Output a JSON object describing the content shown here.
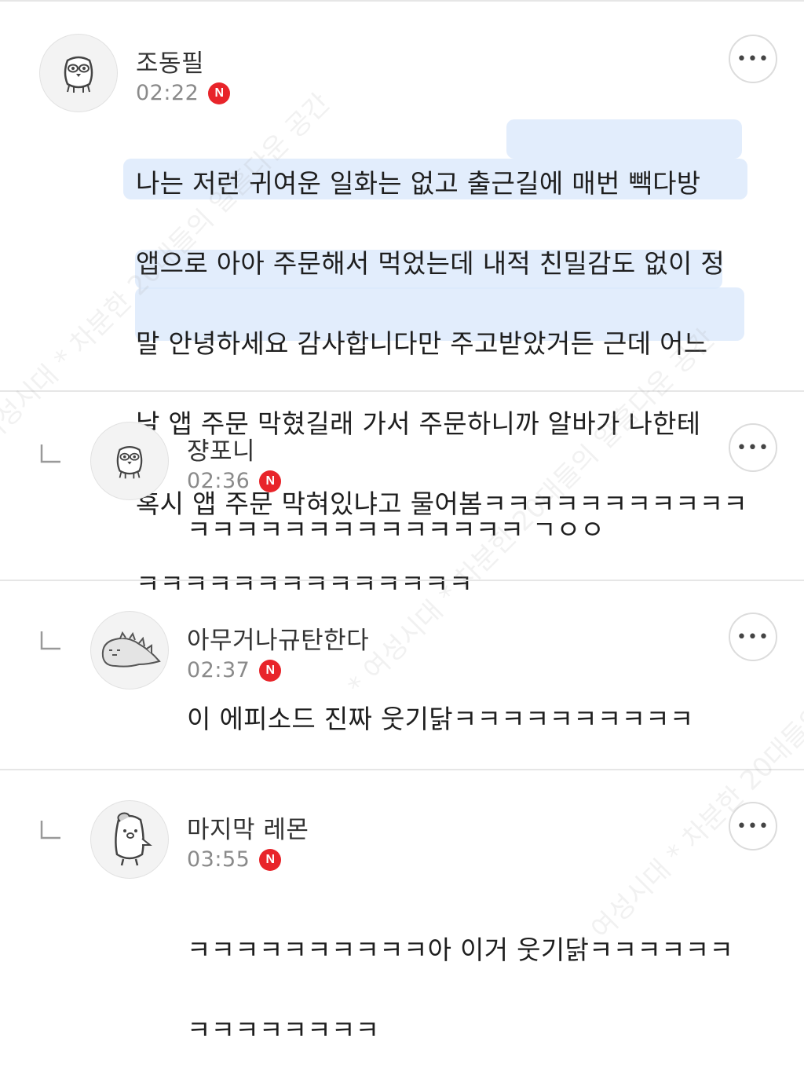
{
  "watermark": "* 여성시대 * 차분한 20대들의 알흠다운 공간",
  "more_label": "•••",
  "badge_label": "N",
  "badge_color": "#e8242a",
  "comments": [
    {
      "nickname": "조동필",
      "time": "02:22",
      "lines": [
        "나는 저런 귀여운 일화는 없고 출근길에 매번 빽다방",
        "앱으로 아아 주문해서 먹었는데 내적 친밀감도 없이 정",
        "말 안녕하세요 감사합니다만 주고받았거든 근데 어느",
        "날 앱 주문 막혔길래 가서 주문하니까 알바가 나한테",
        "혹시 앱 주문 막혀있냐고 물어봄ㅋㅋㅋㅋㅋㅋㅋㅋㅋㅋㅋ",
        "ㅋㅋㅋㅋㅋㅋㅋㅋㅋㅋㅋㅋㅋㅋ"
      ],
      "avatar_icon": "owl-character-icon"
    },
    {
      "nickname": "쟝포니",
      "time": "02:36",
      "text": "ㅋㅋㅋㅋㅋㅋㅋㅋㅋㅋㅋㅋㅋㅋ ㄱㅇㅇ",
      "avatar_icon": "owl-character-icon"
    },
    {
      "nickname": "아무거나규탄한다",
      "time": "02:37",
      "text": "이 에피소드 진짜 웃기닭ㅋㅋㅋㅋㅋㅋㅋㅋㅋㅋ",
      "avatar_icon": "dinosaur-character-icon"
    },
    {
      "nickname": "마지막 레몬",
      "time": "03:55",
      "lines": [
        "ㅋㅋㅋㅋㅋㅋㅋㅋㅋㅋ아 이거 웃기닭ㅋㅋㅋㅋㅋㅋ",
        "ㅋㅋㅋㅋㅋㅋㅋㅋ"
      ],
      "avatar_icon": "penguin-character-icon"
    }
  ]
}
